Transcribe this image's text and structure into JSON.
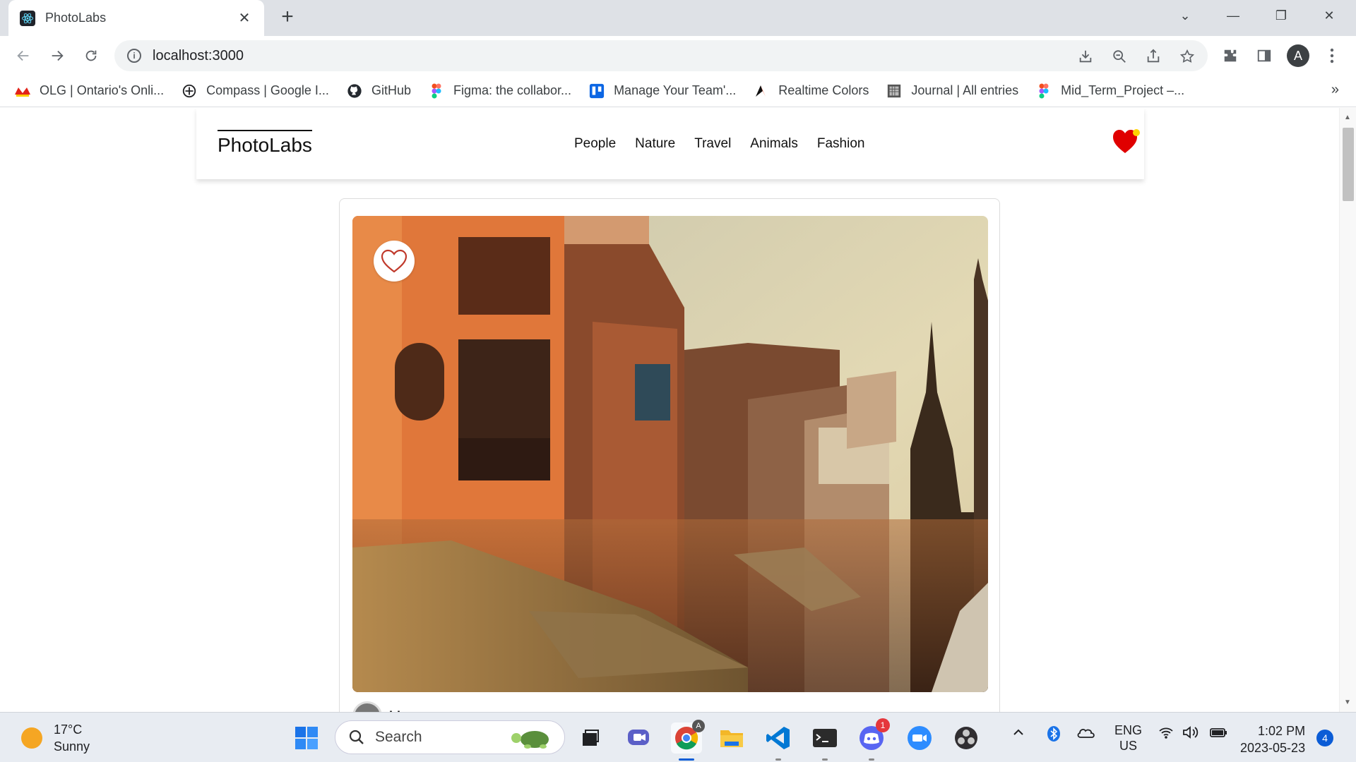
{
  "browser": {
    "tab_title": "PhotoLabs",
    "tab_close": "✕",
    "new_tab": "+",
    "url": "localhost:3000",
    "profile_initial": "A",
    "window_controls": [
      "⌄",
      "—",
      "❐",
      "✕"
    ]
  },
  "bookmarks": [
    {
      "label": "OLG | Ontario's Onli...",
      "icon": "olg-icon"
    },
    {
      "label": "Compass | Google I...",
      "icon": "compass-icon"
    },
    {
      "label": "GitHub",
      "icon": "github-icon"
    },
    {
      "label": "Figma: the collabor...",
      "icon": "figma-icon"
    },
    {
      "label": "Manage Your Team'...",
      "icon": "trello-icon"
    },
    {
      "label": "Realtime Colors",
      "icon": "realtime-colors-icon"
    },
    {
      "label": "Journal | All entries",
      "icon": "journal-icon"
    },
    {
      "label": "Mid_Term_Project –...",
      "icon": "figma-icon"
    }
  ],
  "bookmarks_more": "»",
  "app": {
    "brand": "PhotoLabs",
    "topics": [
      "People",
      "Nature",
      "Travel",
      "Animals",
      "Fashion"
    ],
    "photo": {
      "username": "jdoe",
      "liked": false
    },
    "colors": {
      "heart": "#e00000",
      "notification_dot": "#ffd400"
    }
  },
  "taskbar": {
    "weather_temp": "17°C",
    "weather_desc": "Sunny",
    "search_label": "Search",
    "lang_1": "ENG",
    "lang_2": "US",
    "time": "1:02 PM",
    "date": "2023-05-23",
    "notifications": "4",
    "discord_badge": "1",
    "chrome_badge": "A"
  }
}
